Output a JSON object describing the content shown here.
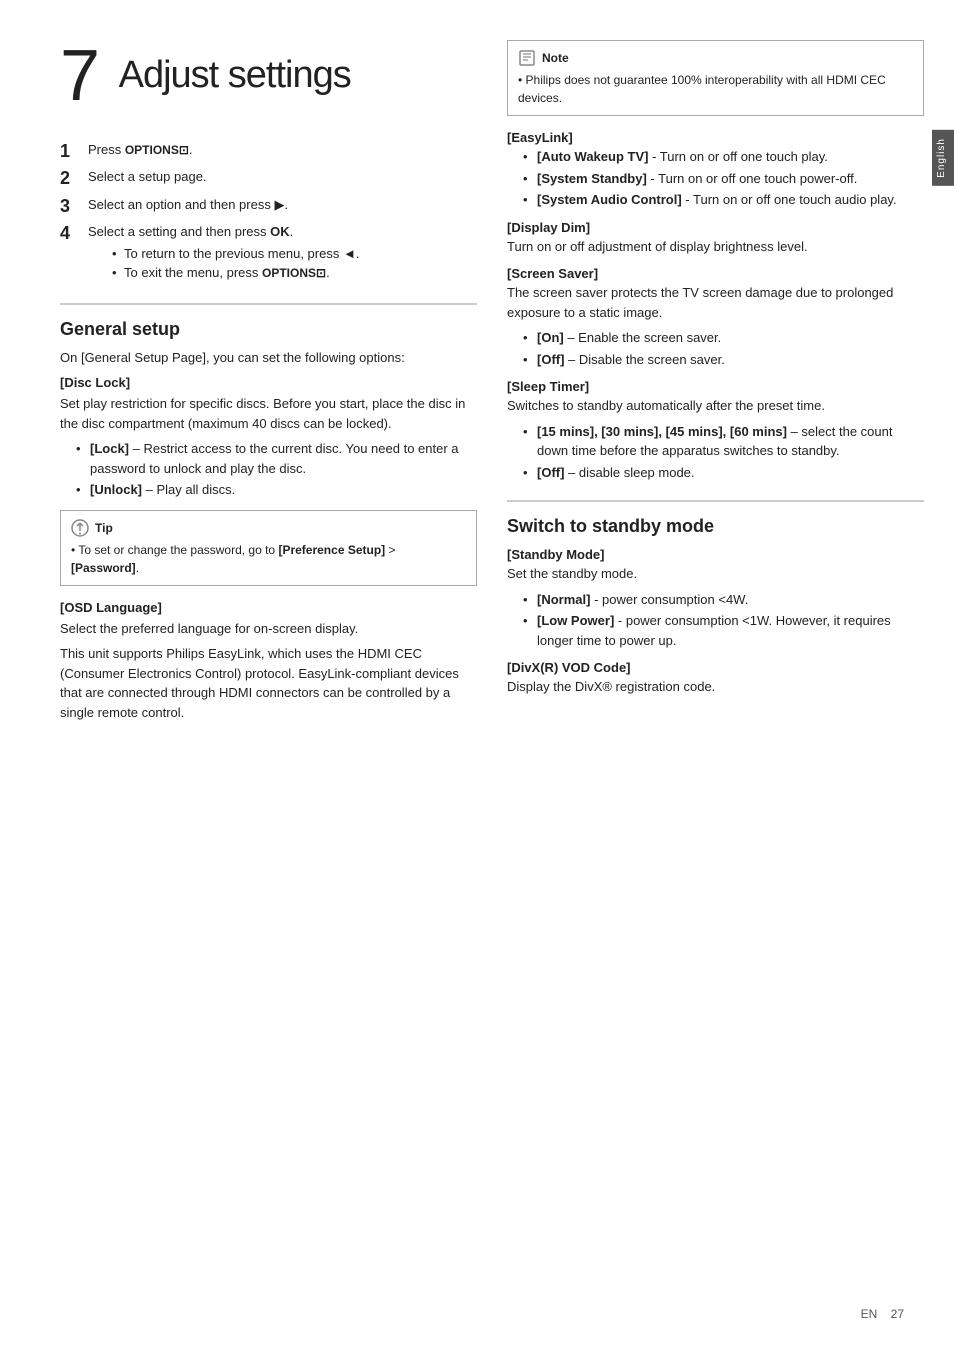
{
  "page": {
    "chapter_number": "7",
    "chapter_title": "Adjust settings",
    "side_tab_text": "English"
  },
  "steps": [
    {
      "num": "1",
      "text": "Press ",
      "bold": "OPTIONS",
      "symbol": "⊡",
      "after": "."
    },
    {
      "num": "2",
      "text": "Select a setup page."
    },
    {
      "num": "3",
      "text": "Select an option and then press ▶."
    },
    {
      "num": "4",
      "text": "Select a setting and then press ",
      "bold": "OK",
      "after": ".",
      "substeps": [
        "To return to the previous menu, press ◄.",
        "To exit the menu, press OPTIONS⊡."
      ]
    }
  ],
  "general_setup": {
    "heading": "General setup",
    "intro": "On [General Setup Page], you can set the following options:",
    "disc_lock": {
      "heading": "[Disc Lock]",
      "body": "Set play restriction for specific discs. Before you start, place the disc in the disc compartment (maximum 40 discs can be locked).",
      "bullets": [
        "[Lock] – Restrict access to the current disc. You need to enter a password to unlock and play the disc.",
        "[Unlock] – Play all discs."
      ]
    },
    "tip": {
      "icon": "tip",
      "text": "To set or change the password, go to [Preference Setup] > [Password]."
    },
    "osd_language": {
      "heading": "[OSD Language]",
      "body": "Select the preferred language for on-screen display."
    },
    "easylink_intro": "This unit supports Philips EasyLink, which uses the HDMI CEC (Consumer Electronics Control) protocol. EasyLink-compliant devices that are connected through HDMI connectors can be controlled by a single remote control."
  },
  "right_col": {
    "note": {
      "header": "Note",
      "text": "Philips does not guarantee 100% interoperability with all HDMI CEC devices."
    },
    "easylink": {
      "heading": "[EasyLink]",
      "bullets": [
        "[Auto Wakeup TV] - Turn on or off one touch play.",
        "[System Standby] - Turn on or off one touch power-off.",
        "[System Audio Control] - Turn on or off one touch audio play."
      ]
    },
    "display_dim": {
      "heading": "[Display Dim]",
      "body": "Turn on or off adjustment of display brightness level."
    },
    "screen_saver": {
      "heading": "[Screen Saver]",
      "body": "The screen saver protects the TV screen damage due to prolonged exposure to a static image.",
      "bullets": [
        "[On] – Enable the screen saver.",
        "[Off] – Disable the screen saver."
      ]
    },
    "sleep_timer": {
      "heading": "[Sleep Timer]",
      "body": "Switches to standby automatically after the preset time.",
      "bullets": [
        "[15 mins], [30 mins], [45 mins], [60 mins] – select the count down time before the apparatus switches to standby.",
        "[Off] – disable sleep mode."
      ]
    },
    "switch_standby": {
      "heading": "Switch to standby mode",
      "standby_mode": {
        "heading": "[Standby Mode]",
        "body": "Set the standby mode.",
        "bullets": [
          "[Normal] - power consumption <4W.",
          "[Low Power] - power consumption <1W. However, it requires longer time to power up."
        ]
      },
      "divx_code": {
        "heading": "[DivX(R) VOD Code]",
        "body": "Display the DivX® registration code."
      }
    }
  },
  "footer": {
    "lang": "EN",
    "page_num": "27"
  }
}
